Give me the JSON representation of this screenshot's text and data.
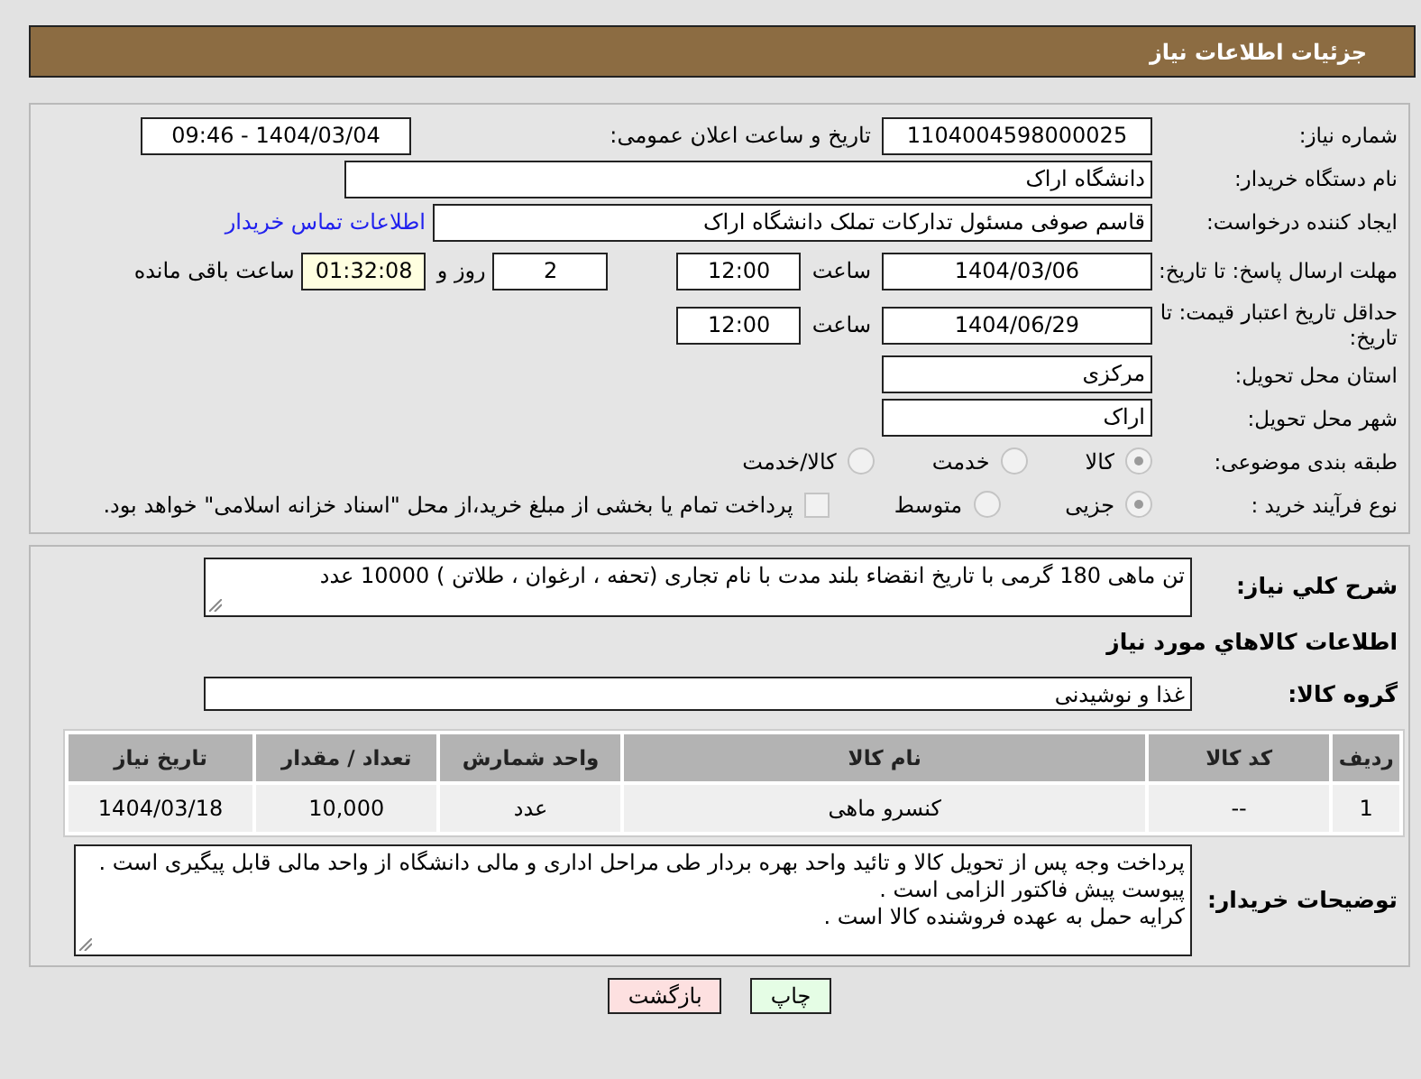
{
  "header": {
    "title": "جزئیات اطلاعات نیاز"
  },
  "need_number": {
    "label": "شماره نیاز:",
    "value": "1104004598000025"
  },
  "announce": {
    "label": "تاریخ و ساعت اعلان عمومی:",
    "value": "1404/03/04 - 09:46"
  },
  "buyer": {
    "label": "نام دستگاه خریدار:",
    "value": "دانشگاه اراک"
  },
  "creator": {
    "label": "ایجاد کننده درخواست:",
    "value": "قاسم صوفی مسئول تدارکات تملک دانشگاه اراک",
    "link": "اطلاعات تماس خریدار"
  },
  "deadline": {
    "label": "مهلت ارسال پاسخ: تا تاریخ:",
    "date": "1404/03/06",
    "time_label": "ساعت",
    "time": "12:00",
    "days": "2",
    "days_label": "روز و",
    "remaining": "01:32:08",
    "remaining_label": "ساعت باقی مانده"
  },
  "validity": {
    "label": "حداقل تاریخ اعتبار قیمت: تا تاریخ:",
    "date": "1404/06/29",
    "time_label": "ساعت",
    "time": "12:00"
  },
  "province": {
    "label": "استان محل تحویل:",
    "value": "مرکزی"
  },
  "city": {
    "label": "شهر محل تحویل:",
    "value": "اراک"
  },
  "category": {
    "label": "طبقه بندی موضوعی:",
    "options": [
      {
        "label": "کالا",
        "selected": true
      },
      {
        "label": "خدمت",
        "selected": false
      },
      {
        "label": "کالا/خدمت",
        "selected": false
      }
    ]
  },
  "process": {
    "label": "نوع فرآیند خرید :",
    "options": [
      {
        "label": "جزیی",
        "selected": true
      },
      {
        "label": "متوسط",
        "selected": false
      }
    ],
    "payment": {
      "label": "پرداخت تمام یا بخشی از مبلغ خرید،از محل \"اسناد خزانه اسلامی\" خواهد بود.",
      "checked": false
    }
  },
  "description": {
    "label": "شرح کلي نياز:",
    "value": "تن ماهی 180 گرمی با تاریخ انقضاء بلند مدت با نام تجاری (تحفه ، ارغوان ، طلاتن ) 10000 عدد"
  },
  "goods_title": "اطلاعات کالاهاي مورد نياز",
  "group": {
    "label": "گروه کالا:",
    "value": "غذا و نوشیدنی"
  },
  "table": {
    "columns": [
      "ردیف",
      "کد کالا",
      "نام کالا",
      "واحد شمارش",
      "تعداد / مقدار",
      "تاریخ نیاز"
    ],
    "rows": [
      [
        "1",
        "--",
        "کنسرو ماهی",
        "عدد",
        "10,000",
        "1404/03/18"
      ]
    ]
  },
  "buyer_notes": {
    "label": "توضیحات خریدار:",
    "lines": [
      "پرداخت وجه پس از تحویل کالا و تائید واحد بهره بردار طی مراحل اداری و مالی دانشگاه از واحد مالی قابل پیگیری است .",
      "پیوست پیش فاکتور الزامی است .",
      "کرایه حمل به عهده فروشنده کالا است ."
    ]
  },
  "buttons": [
    {
      "label": "چاپ",
      "kind": "print"
    },
    {
      "label": "بازگشت",
      "kind": "back"
    }
  ]
}
